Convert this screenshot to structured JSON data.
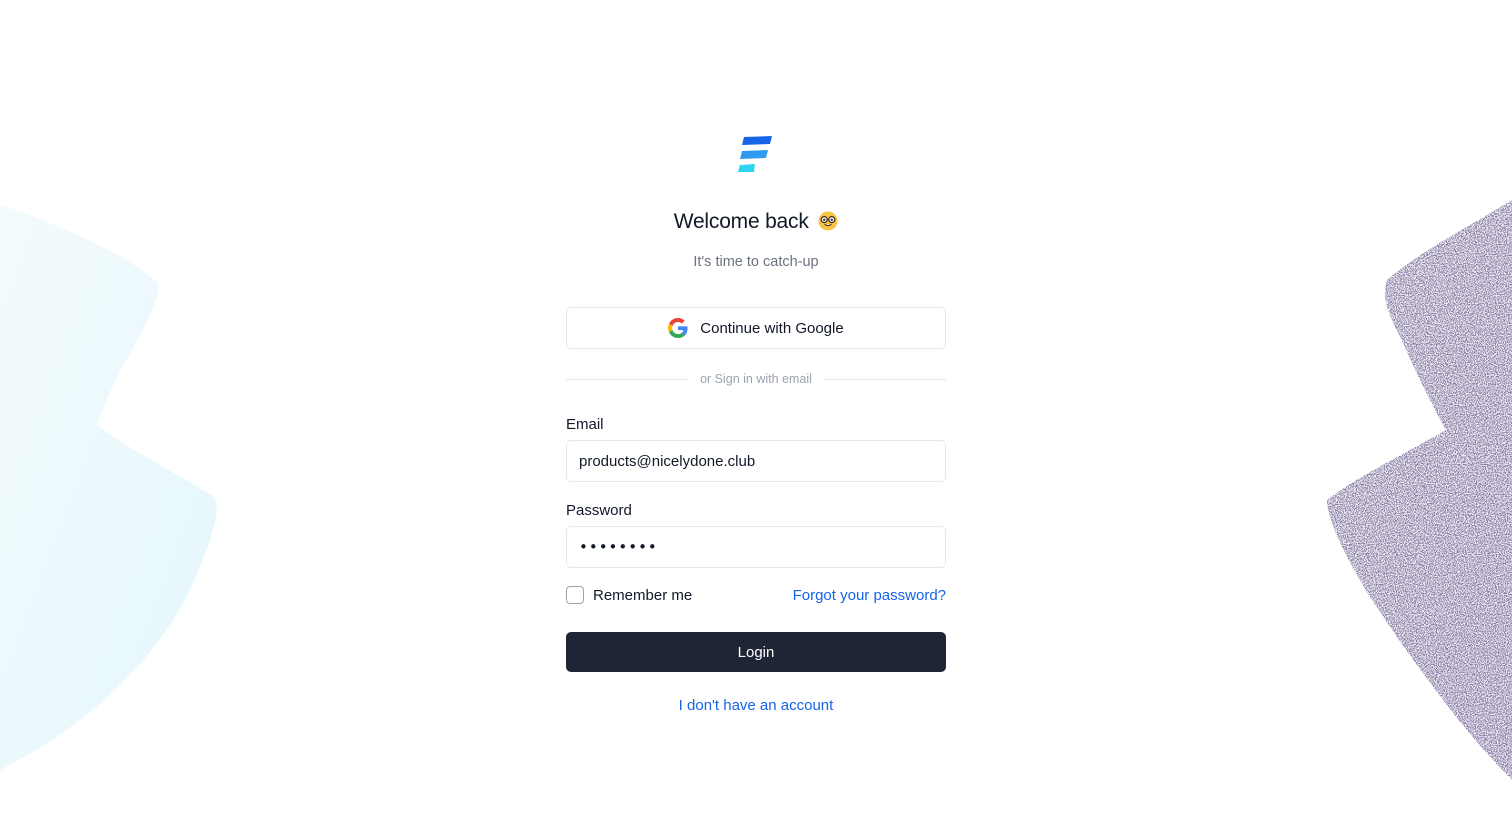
{
  "app": {
    "logo_icon": "stacked-bars-logo",
    "brand_colors": [
      "#1664e8",
      "#2f9bf0",
      "#2dd4f0"
    ]
  },
  "header": {
    "title": "Welcome back",
    "title_emoji": "nerd-face-emoji",
    "subtitle": "It's time to catch-up"
  },
  "google": {
    "label": "Continue with Google",
    "icon": "google-icon"
  },
  "divider": {
    "text": "or Sign in with email"
  },
  "form": {
    "email_label": "Email",
    "email_value": "products@nicelydone.club",
    "password_label": "Password",
    "password_value": "••••••••",
    "remember_label": "Remember me",
    "remember_checked": false,
    "forgot_label": "Forgot your password?",
    "login_label": "Login"
  },
  "footer": {
    "signup_label": "I don't have an account"
  },
  "colors": {
    "accent": "#1664e8",
    "button_bg": "#1e2535",
    "deco_left": "#e6f7fc",
    "deco_right": "#e8e0f7"
  }
}
